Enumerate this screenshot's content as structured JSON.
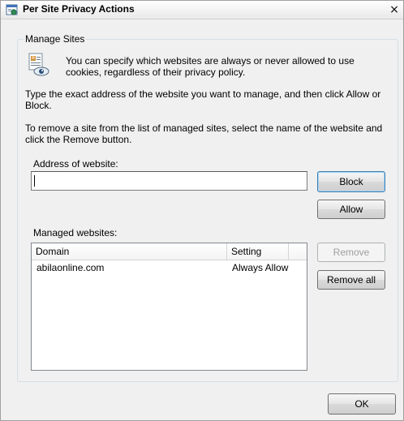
{
  "window": {
    "title": "Per Site Privacy Actions",
    "close_glyph": "×"
  },
  "group": {
    "legend": "Manage Sites",
    "intro": "You can specify which websites are always or never allowed to use cookies, regardless of their privacy policy.",
    "type_instructions": "Type the exact address of the website you want to manage, and then click Allow or Block.",
    "remove_instructions": "To remove a site from the list of managed sites, select the name of the website and click the Remove button.",
    "address_label": "Address of website:",
    "address_value": "",
    "managed_label": "Managed websites:"
  },
  "buttons": {
    "block": "Block",
    "allow": "Allow",
    "remove": "Remove",
    "remove_all": "Remove all",
    "ok": "OK"
  },
  "table": {
    "headers": [
      "Domain",
      "Setting"
    ],
    "rows": [
      {
        "domain": "abilaonline.com",
        "setting": "Always Allow"
      }
    ]
  },
  "icons": {
    "title": "privacy-window-icon",
    "info": "privacy-report-icon",
    "close": "close-icon"
  }
}
